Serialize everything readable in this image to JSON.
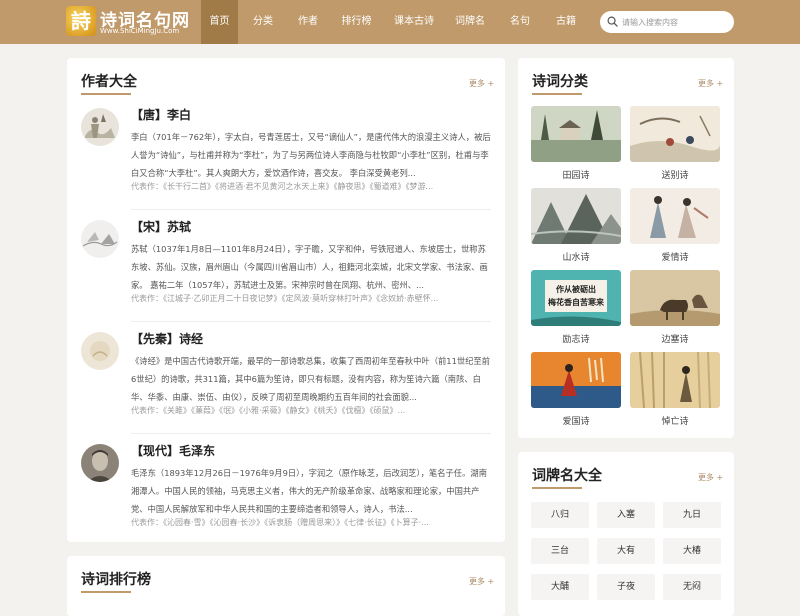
{
  "header": {
    "logo_mark": "詩",
    "logo_title": "诗词名句网",
    "logo_url": "Www.ShiCiMingJu.Com",
    "nav": [
      {
        "label": "首页",
        "active": true
      },
      {
        "label": "分类"
      },
      {
        "label": "作者"
      },
      {
        "label": "排行榜"
      },
      {
        "label": "课本古诗"
      },
      {
        "label": "词牌名"
      },
      {
        "label": "名句"
      },
      {
        "label": "古籍"
      }
    ],
    "search_placeholder": "请输入搜索内容"
  },
  "authors_panel": {
    "title": "作者大全",
    "more": "更多 +",
    "authors": [
      {
        "name": "【唐】李白",
        "bio": "李白（701年－762年），字太白，号青莲居士，又号“谪仙人”，是唐代伟大的浪漫主义诗人，被后人誉为“诗仙”，与杜甫并称为“李杜”，为了与另两位诗人李商隐与杜牧即“小李杜”区别，杜甫与李白又合称“大李杜”。其人爽朗大方，爱饮酒作诗，喜交友。 李白深受黄老列...",
        "works": "代表作：《长干行二首》《将进酒·君不见黄河之水天上来》《静夜思》《蜀道难》《梦游..."
      },
      {
        "name": "【宋】苏轼",
        "bio": "苏轼（1037年1月8日—1101年8月24日），字子瞻，又字和仲，号铁冠道人、东坡居士，世称苏东坡、苏仙。汉族，眉州眉山（今属四川省眉山市）人，祖籍河北栾城，北宋文学家、书法家、画家。 嘉祐二年（1057年），苏轼进士及第。宋神宗时曾在凤翔、杭州、密州、...",
        "works": "代表作：《江城子·乙卯正月二十日夜记梦》《定风波·莫听穿林打叶声》《念奴娇·赤壁怀..."
      },
      {
        "name": "【先秦】诗经",
        "bio": "《诗经》是中国古代诗歌开端，最早的一部诗歌总集，收集了西周初年至春秋中叶（前11世纪至前6世纪）的诗歌，共311篇，其中6篇为笙诗，即只有标题，没有内容，称为笙诗六篇（南陔、白华、华黍、由康、崇伍、由仪），反映了周初至周晚期约五百年间的社会面貌...",
        "works": "代表作：《关雎》《蒹葭》《氓》《小雅·采薇》《静女》《桃夭》《伐檀》《硕鼠》..."
      },
      {
        "name": "【现代】毛泽东",
        "bio": "毛泽东（1893年12月26日－1976年9月9日），字润之（原作咏芝，后改润芝），笔名子任。湖南湘潭人。中国人民的领袖，马克思主义者，伟大的无产阶级革命家、战略家和理论家，中国共产党、中国人民解放军和中华人民共和国的主要缔造者和领导人，诗人，书法...",
        "works": "代表作：《沁园春·雪》《沁园春·长沙》《诉衷肠（赠周恩来）》《七律·长征》《卜算子·..."
      }
    ]
  },
  "ranking_panel": {
    "title": "诗词排行榜",
    "more": "更多 +"
  },
  "categories_panel": {
    "title": "诗词分类",
    "more": "更多 +",
    "items": [
      {
        "label": "田园诗"
      },
      {
        "label": "送别诗"
      },
      {
        "label": "山水诗"
      },
      {
        "label": "爱情诗"
      },
      {
        "label": "励志诗"
      },
      {
        "label": "边塞诗"
      },
      {
        "label": "爱国诗"
      },
      {
        "label": "悼亡诗"
      }
    ],
    "img_text_lizhi": "作从被砺出 梅花香自苦寒来"
  },
  "cipai_panel": {
    "title": "词牌名大全",
    "more": "更多 +",
    "tags": [
      "八归",
      "入塞",
      "九日",
      "三台",
      "大有",
      "大椿",
      "大酺",
      "子夜",
      "无闷"
    ]
  },
  "colors": {
    "header_bg": "#c09a6a",
    "nav_active": "#a07a47",
    "accent": "#c09a6a"
  }
}
